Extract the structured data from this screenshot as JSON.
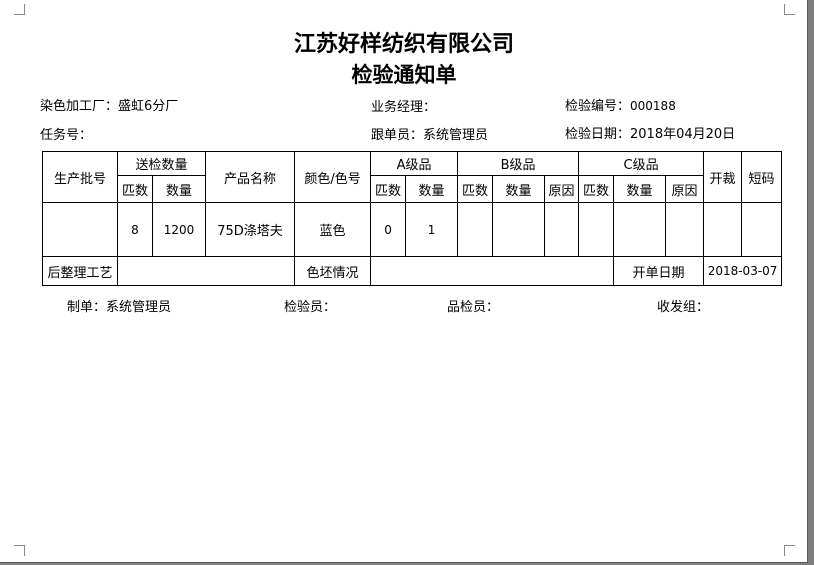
{
  "company": "江苏好样纺织有限公司",
  "doc_title": "检验通知单",
  "header": {
    "dye_factory_label": "染色加工厂：",
    "dye_factory_value": "盛虹6分厂",
    "manager_label": "业务经理：",
    "inspect_no_label": "检验编号：",
    "inspect_no_value": "000188",
    "task_no_label": "任务号：",
    "follower_label": "跟单员：",
    "follower_value": "系统管理员",
    "inspect_date_label": "检验日期：",
    "inspect_date_value": "2018年04月20日"
  },
  "table": {
    "batch_no": "生产批号",
    "sent_qty": "送检数量",
    "pieces": "匹数",
    "quantity": "数量",
    "product_name": "产品名称",
    "color_no": "颜色/色号",
    "grade_a": "A级品",
    "grade_b": "B级品",
    "grade_c": "C级品",
    "reason": "原因",
    "cutting": "开裁",
    "short_code": "短码",
    "row": {
      "batch_no": "",
      "pieces": "8",
      "quantity": "1200",
      "product_name": "75D涤塔夫",
      "color": "蓝色",
      "a_pieces": "0",
      "a_quantity": "1"
    },
    "finishing_label": "后整理工艺",
    "greige_label": "色坯情况",
    "open_date_label": "开单日期",
    "open_date_value": "2018-03-07"
  },
  "footer": {
    "maker_label": "制单：",
    "maker_value": "系统管理员",
    "inspector_label": "检验员：",
    "qc_label": "品检员：",
    "dispatch_label": "收发组："
  }
}
